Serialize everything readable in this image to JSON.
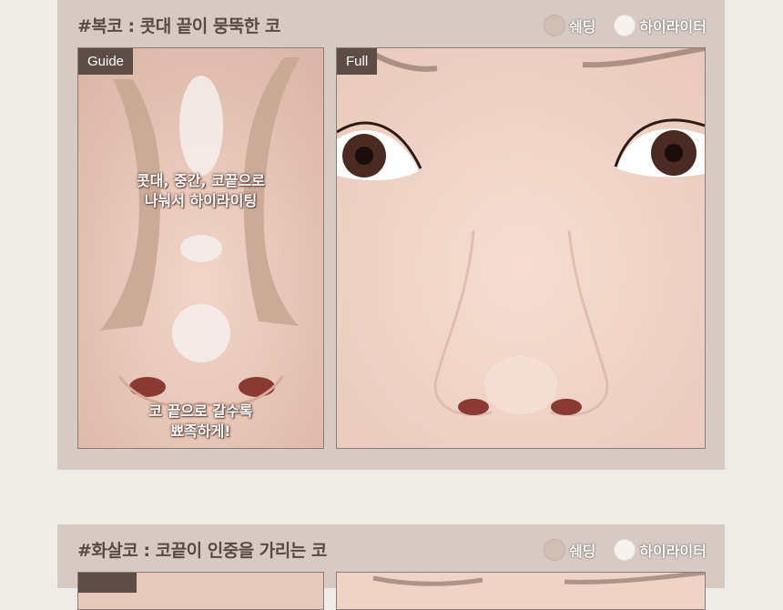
{
  "legend": {
    "shading_label": "쉐딩",
    "highlight_label": "하이라이터"
  },
  "section1": {
    "title": "#복코 : 콧대 끝이 뭉뚝한 코",
    "guide_tag": "Guide",
    "full_tag": "Full",
    "caption_top_line1": "콧대, 중간, 코끝으로",
    "caption_top_line2": "나눠서 하이라이팅",
    "caption_bottom_line1": "코 끝으로 갈수록",
    "caption_bottom_line2": "뾰족하게!"
  },
  "section2": {
    "title": "#화살코 : 코끝이 인중을 가리는 코"
  }
}
